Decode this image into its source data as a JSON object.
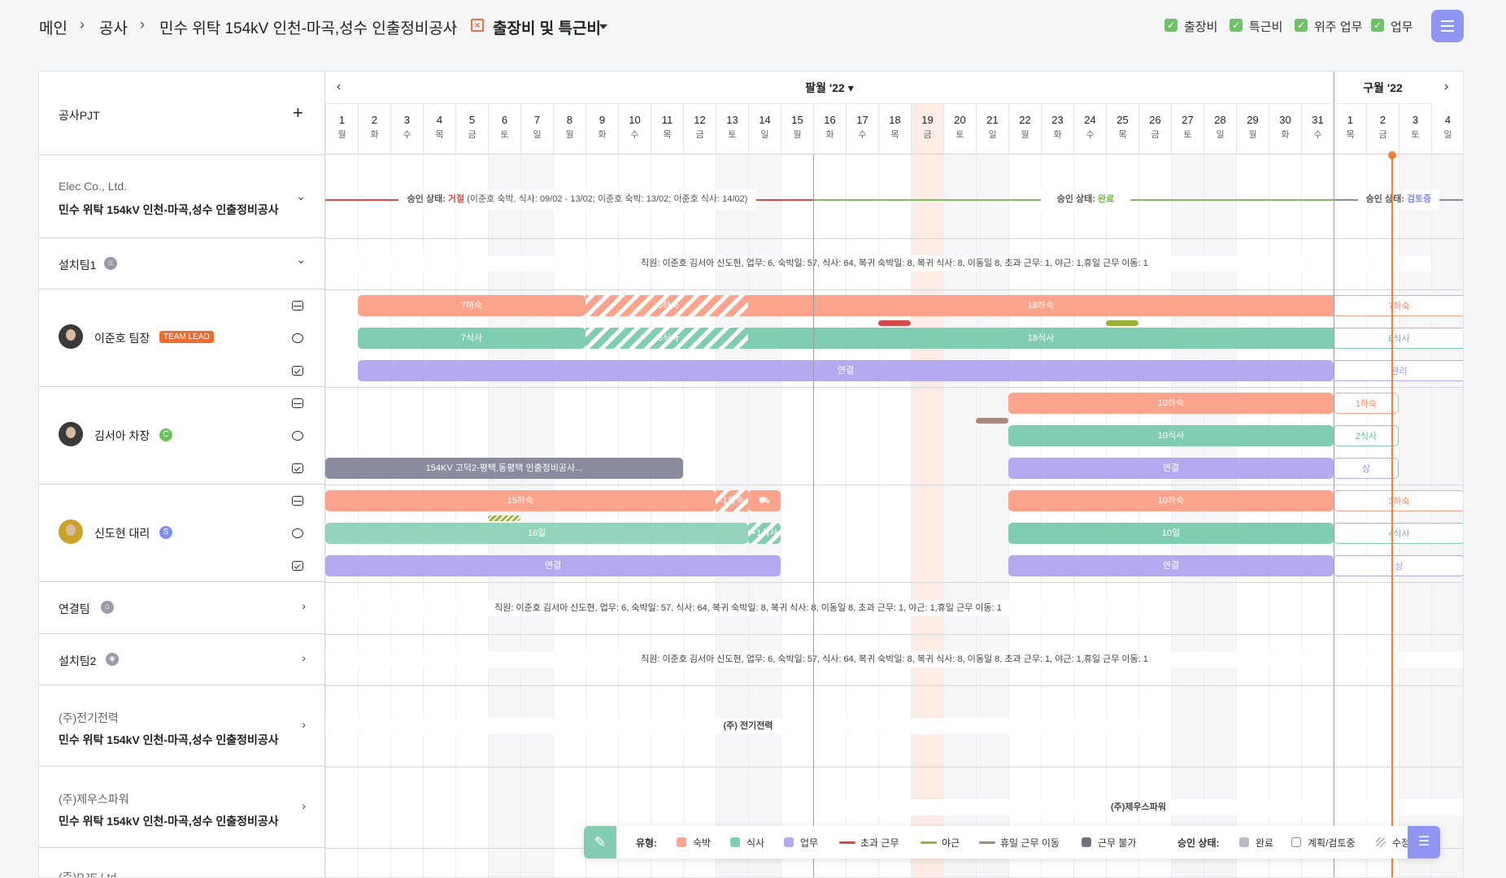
{
  "breadcrumb": {
    "home": "메인",
    "construction": "공사",
    "project": "민수 위탁 154kV 인천-마곡,성수 인출정비공사",
    "current": "출장비 및 특근비"
  },
  "filters": [
    {
      "label": "출장비",
      "checked": true
    },
    {
      "label": "특근비",
      "checked": true
    },
    {
      "label": "위주 업무",
      "checked": true
    },
    {
      "label": "업무",
      "checked": true
    }
  ],
  "colors": {
    "accent": "#8f95f0",
    "lodging": "#fba38c",
    "meal": "#81cdb1",
    "work": "#b3aaf0",
    "overtime": "#d9534f",
    "night": "#9ab23a",
    "holiday_move": "#a68a82",
    "unavailable": "#6f7180",
    "today": "#f47f3a"
  },
  "left": {
    "header": "공사PJT",
    "company1": {
      "name": "Elec Co., Ltd.",
      "project": "민수 위탁 154kV 인천-마곡,성수 인출정비공사"
    },
    "team1": {
      "name": "설치팀1"
    },
    "members": [
      {
        "name": "이준호 팀장",
        "badge": "TEAM LEAD"
      },
      {
        "name": "김서아 차장",
        "badge": "C"
      },
      {
        "name": "신도현 대리",
        "badge": "S"
      }
    ],
    "team2": {
      "name": "연결팀"
    },
    "team3": {
      "name": "설치팀2"
    },
    "company2": {
      "name": "(주)전기전력",
      "project": "민수 위탁 154kV 인천-마곡,성수 인출정비공사"
    },
    "company3": {
      "name": "(주)제우스파워",
      "project": "민수 위탁 154kV 인천-마곡,성수 인출정비공사"
    },
    "company4": {
      "name": "(주)PJE Ltd."
    }
  },
  "calendar": {
    "aug_label": "팔월 '22",
    "sep_label": "구월 '22",
    "days": [
      {
        "n": "1",
        "w": "월"
      },
      {
        "n": "2",
        "w": "화"
      },
      {
        "n": "3",
        "w": "수"
      },
      {
        "n": "4",
        "w": "목"
      },
      {
        "n": "5",
        "w": "금"
      },
      {
        "n": "6",
        "w": "토"
      },
      {
        "n": "7",
        "w": "일"
      },
      {
        "n": "8",
        "w": "월"
      },
      {
        "n": "9",
        "w": "화"
      },
      {
        "n": "10",
        "w": "수"
      },
      {
        "n": "11",
        "w": "목"
      },
      {
        "n": "12",
        "w": "금"
      },
      {
        "n": "13",
        "w": "토"
      },
      {
        "n": "14",
        "w": "일"
      },
      {
        "n": "15",
        "w": "월"
      },
      {
        "n": "16",
        "w": "화"
      },
      {
        "n": "17",
        "w": "수"
      },
      {
        "n": "18",
        "w": "목"
      },
      {
        "n": "19",
        "w": "금"
      },
      {
        "n": "20",
        "w": "토"
      },
      {
        "n": "21",
        "w": "일"
      },
      {
        "n": "22",
        "w": "월"
      },
      {
        "n": "23",
        "w": "화"
      },
      {
        "n": "24",
        "w": "수"
      },
      {
        "n": "25",
        "w": "목"
      },
      {
        "n": "26",
        "w": "금"
      },
      {
        "n": "27",
        "w": "토"
      },
      {
        "n": "28",
        "w": "일"
      },
      {
        "n": "29",
        "w": "월"
      },
      {
        "n": "30",
        "w": "화"
      },
      {
        "n": "31",
        "w": "수"
      },
      {
        "n": "1",
        "w": "목"
      },
      {
        "n": "2",
        "w": "금"
      },
      {
        "n": "3",
        "w": "토"
      },
      {
        "n": "4",
        "w": "일"
      }
    ]
  },
  "approval": {
    "label": "승인 상태:",
    "rejected": "거절",
    "rejected_detail": "(이준호 숙박, 식사: 09/02 - 13/02; 이준호 숙박: 13/02; 이준호 식사: 14/02)",
    "done": "완료",
    "review": "검토중"
  },
  "staff_note": "직원: 이준호 김서아 신도현, 업무: 6, 숙박일: 57, 식사: 64, 복귀 숙박일: 8, 복귀 식사: 8, 이동일 8, 초과 근무: 1, 야근: 1,휴일 근무 이동: 1",
  "bars": {
    "m1_lodge_a": "7하숙",
    "m1_lodge_b": "-5하숙",
    "m1_lodge_c": "18하숙",
    "m1_lodge_d": "7하숙",
    "m1_meal_a": "7식사",
    "m1_meal_b": "-5식사",
    "m1_meal_c": "18식사",
    "m1_meal_d": "8식사",
    "m1_work_a": "연결",
    "m1_work_b": "관리",
    "m2_lodge_a": "10하숙",
    "m2_lodge_b": "1하숙",
    "m2_meal_a": "10식사",
    "m2_meal_b": "2식사",
    "m2_work_a": "154KV 고덕2-평택,동평택 인출정비공사...",
    "m2_work_b": "연결",
    "m2_work_c": "상",
    "m3_lodge_a": "15하숙",
    "m3_lodge_b": "-1하숙",
    "m3_lodge_c": "10하숙",
    "m3_lodge_d": "3하숙",
    "m3_meal_a": "16일",
    "m3_meal_b": "+1식사",
    "m3_meal_c": "10일",
    "m3_meal_d": "4식사",
    "m3_work_a": "연결",
    "m3_work_b": "연결",
    "m3_work_c": "상"
  },
  "company_notes": {
    "c2": "(주) 전기전력",
    "c3": "(주)제우스파워"
  },
  "legend": {
    "type_label": "유형:",
    "items": [
      "숙박",
      "식사",
      "업무",
      "초과 근무",
      "야근",
      "휴일 근무 이동",
      "근무 불가"
    ],
    "status_label": "승인 상태:",
    "statuses": [
      "완료",
      "계획/검토중",
      "수정"
    ]
  }
}
